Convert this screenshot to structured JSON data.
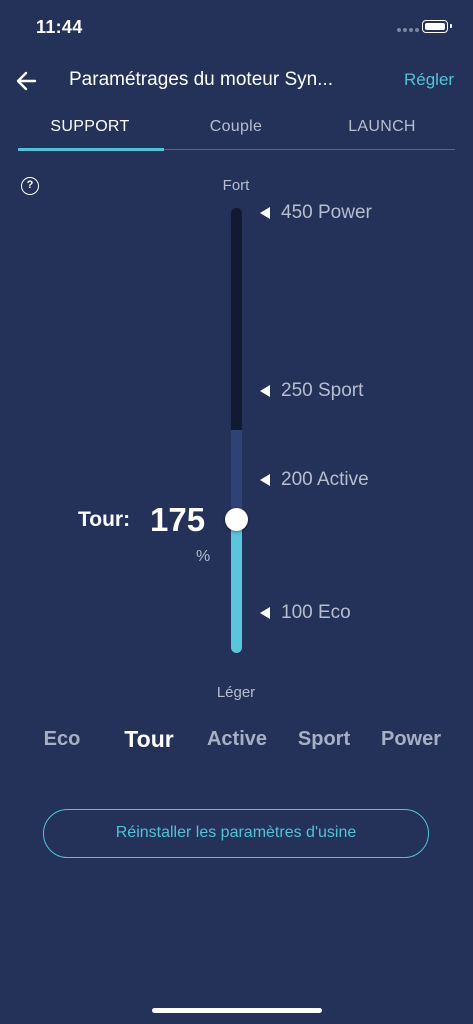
{
  "status_bar": {
    "time": "11:44"
  },
  "header": {
    "title": "Paramétrages du moteur Syn...",
    "apply_label": "Régler"
  },
  "tabs": [
    {
      "label": "SUPPORT",
      "active": true
    },
    {
      "label": "Couple",
      "active": false
    },
    {
      "label": "LAUNCH",
      "active": false
    }
  ],
  "help_icon": "?",
  "slider": {
    "top_label": "Fort",
    "bottom_label": "Léger",
    "markers": [
      {
        "value": "450",
        "name": "Power"
      },
      {
        "value": "250",
        "name": "Sport"
      },
      {
        "value": "200",
        "name": "Active"
      },
      {
        "value": "100",
        "name": "Eco"
      }
    ],
    "current_label": "Tour:",
    "current_value": "175",
    "unit": "%",
    "value_percent": 175
  },
  "modes": [
    {
      "label": "Eco",
      "selected": false
    },
    {
      "label": "Tour",
      "selected": true
    },
    {
      "label": "Active",
      "selected": false
    },
    {
      "label": "Sport",
      "selected": false
    },
    {
      "label": "Power",
      "selected": false
    }
  ],
  "reset_label": "Réinstaller les paramètres d'usine",
  "colors": {
    "background": "#24325a",
    "accent": "#4fc3d6",
    "track_dark": "#111a31"
  }
}
